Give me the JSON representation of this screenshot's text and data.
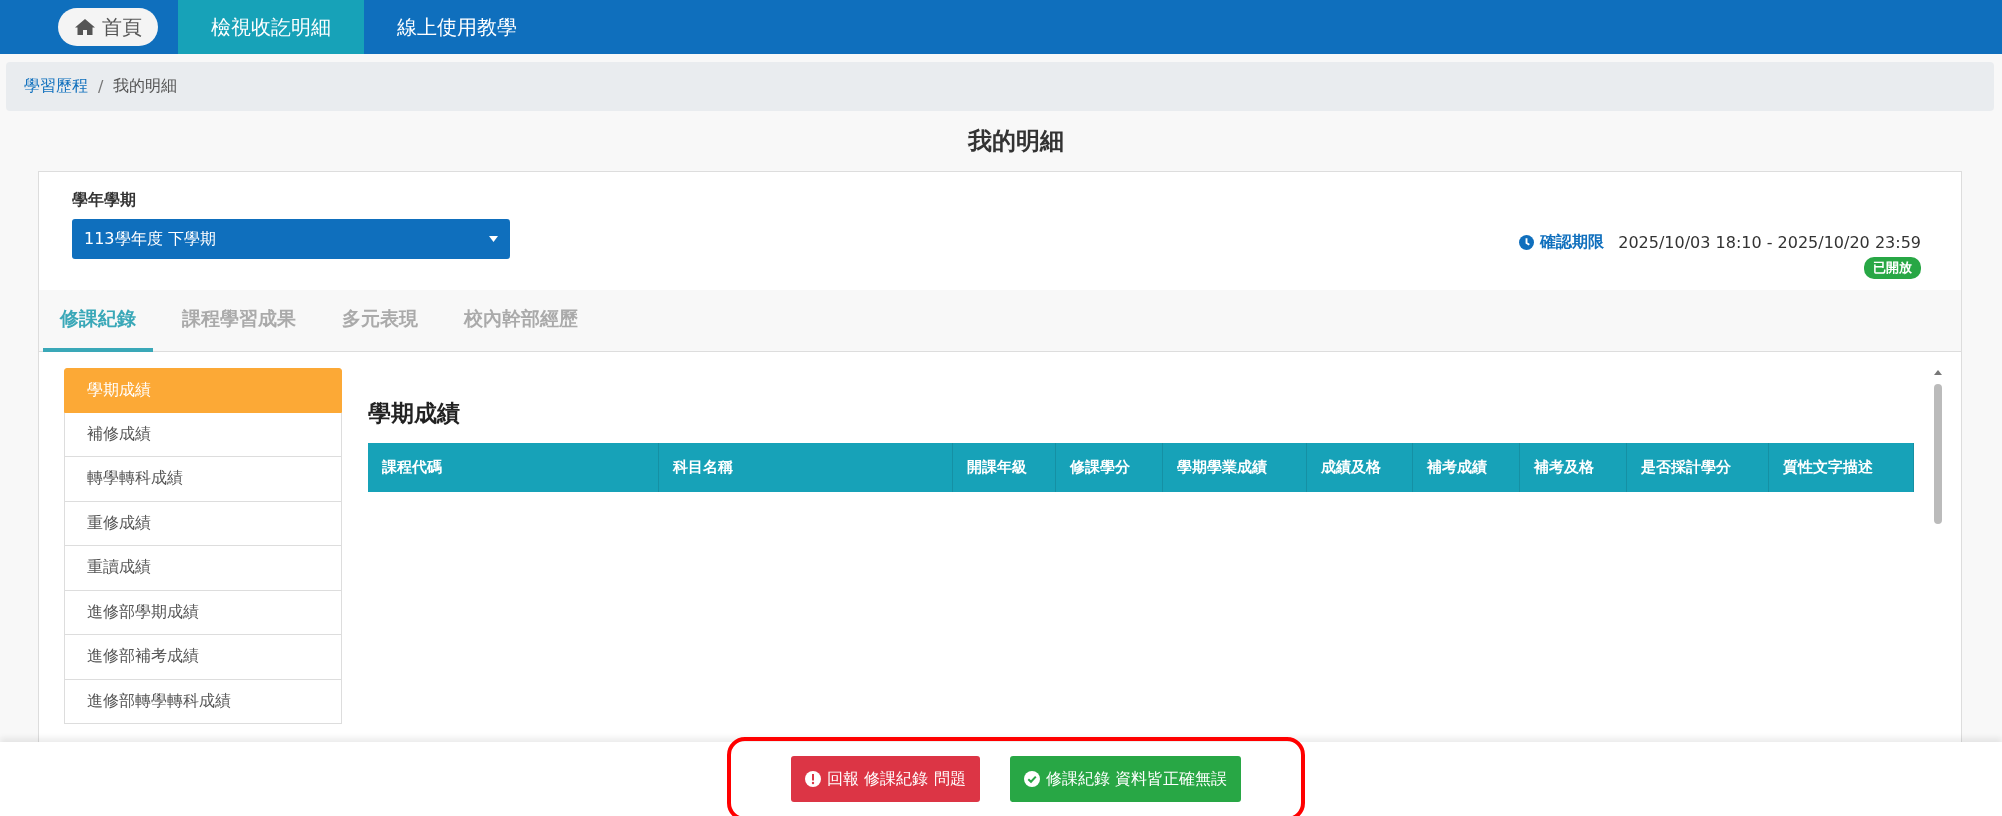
{
  "nav": {
    "items": [
      {
        "label": "首頁",
        "kind": "home",
        "selected": false
      },
      {
        "label": "檢視收訖明細",
        "kind": "link",
        "selected": true
      },
      {
        "label": "線上使用教學",
        "kind": "link",
        "selected": false
      }
    ]
  },
  "breadcrumb": {
    "separator": "/",
    "items": [
      {
        "label": "學習歷程",
        "kind": "link"
      },
      {
        "label": "我的明細",
        "kind": "current"
      }
    ]
  },
  "page_title": "我的明細",
  "term": {
    "label": "學年學期",
    "value": "113學年度 下學期"
  },
  "deadline": {
    "label": "確認期限",
    "range": "2025/10/03 18:10 - 2025/10/20 23:59",
    "status": "已開放"
  },
  "tabs": [
    {
      "label": "修課紀錄",
      "selected": true
    },
    {
      "label": "課程學習成果",
      "selected": false
    },
    {
      "label": "多元表現",
      "selected": false
    },
    {
      "label": "校內幹部經歷",
      "selected": false
    }
  ],
  "sidebar": {
    "items": [
      {
        "label": "學期成績",
        "selected": true
      },
      {
        "label": "補修成績",
        "selected": false
      },
      {
        "label": "轉學轉科成績",
        "selected": false
      },
      {
        "label": "重修成績",
        "selected": false
      },
      {
        "label": "重讀成績",
        "selected": false
      },
      {
        "label": "進修部學期成績",
        "selected": false
      },
      {
        "label": "進修部補考成績",
        "selected": false
      },
      {
        "label": "進修部轉學轉科成績",
        "selected": false
      }
    ]
  },
  "section_title": "學期成績",
  "table": {
    "columns": [
      "課程代碼",
      "科目名稱",
      "開課年級",
      "修課學分",
      "學期學業成績",
      "成績及格",
      "補考成績",
      "補考及格",
      "是否採計學分",
      "質性文字描述"
    ]
  },
  "actions": [
    {
      "label": "回報 修課紀錄 問題",
      "kind": "report"
    },
    {
      "label": "修課紀錄 資料皆正確無誤",
      "kind": "confirm"
    }
  ]
}
